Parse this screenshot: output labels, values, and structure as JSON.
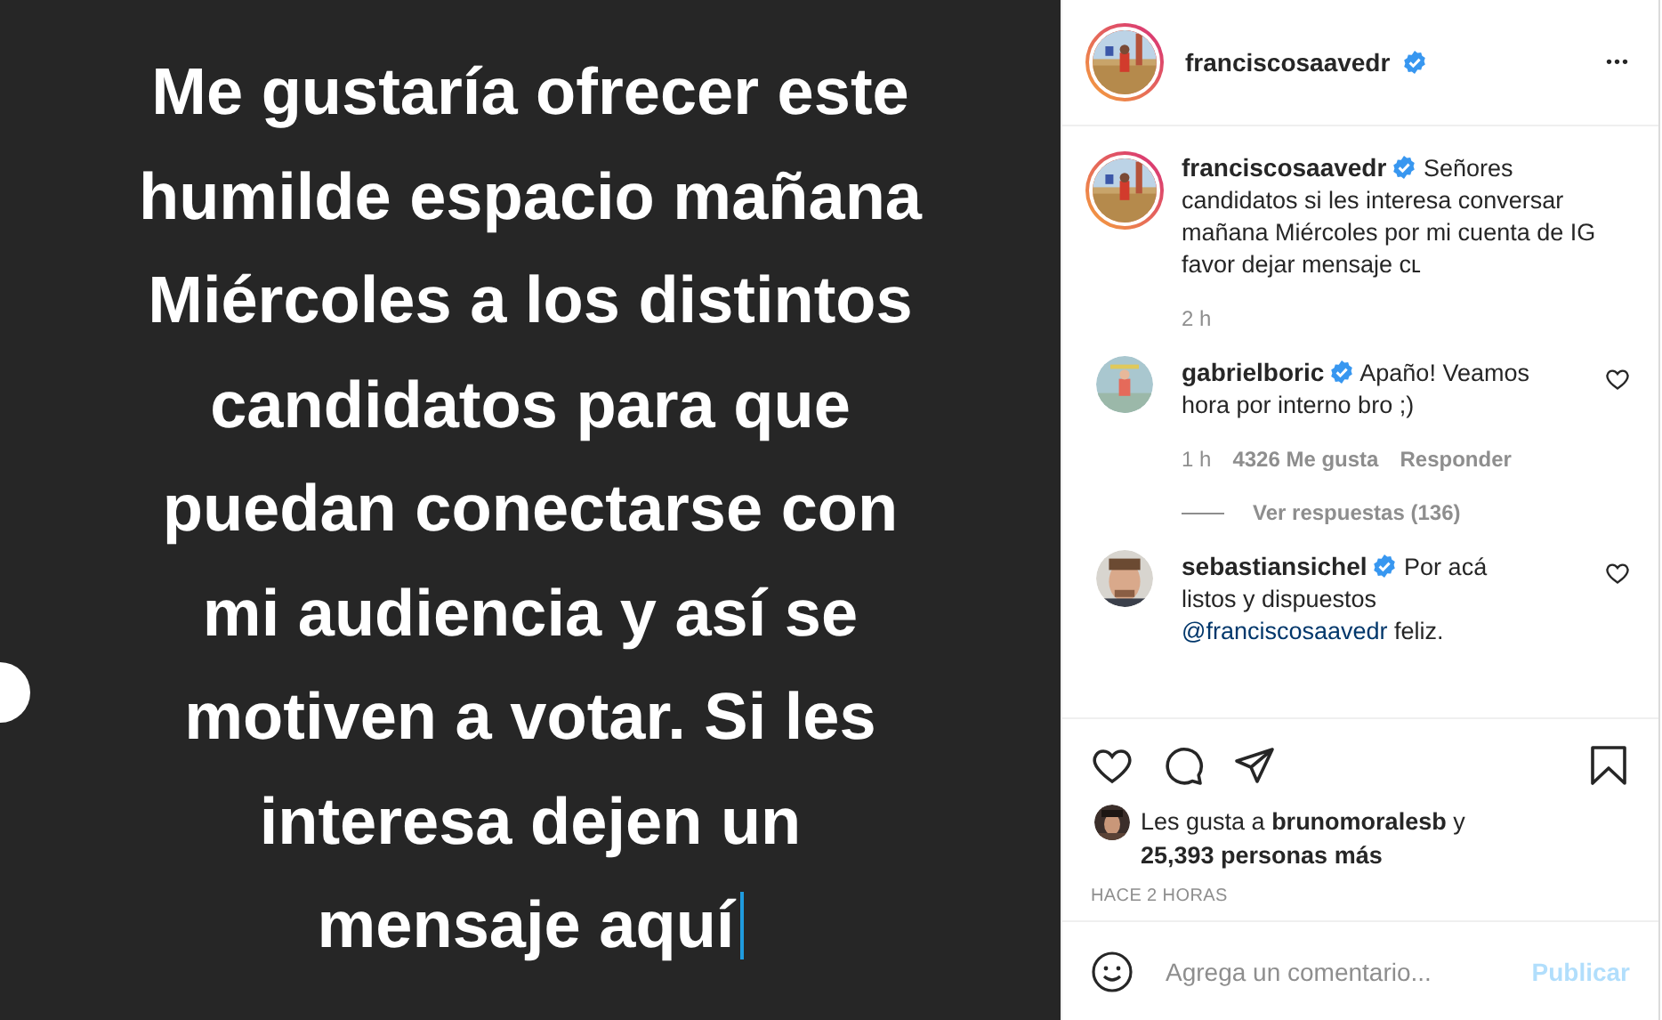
{
  "story": {
    "text": "Me gustaría ofrecer este\nhumilde espacio mañana\nMiércoles a los distintos\ncandidatos para que\npuedan conectarse con\nmi audiencia y así se\nmotiven a votar. Si les\ninteresa dejen un\nmensaje aquí",
    "cursor": true
  },
  "header": {
    "username": "franciscosaavedr",
    "verified": true,
    "more": "•••"
  },
  "caption": {
    "username": "franciscosaavedr",
    "verified": true,
    "text": "Señores candidatos si les interesa conversar mañana Miércoles por mi cuenta de IG favor dejar mensaje cʟ",
    "time": "2 h"
  },
  "comments": [
    {
      "username": "gabrielboric",
      "verified": true,
      "parts": [
        {
          "kind": "text",
          "text": "Apaño! Veamos hora por interno bro ;)"
        }
      ],
      "time": "1 h",
      "likes": "4326 Me gusta",
      "reply": "Responder",
      "replies": "Ver respuestas (136)",
      "liked": false
    },
    {
      "username": "sebastiansichel",
      "verified": true,
      "parts": [
        {
          "kind": "text",
          "text": "Por acá listos y dispuestos "
        },
        {
          "kind": "mention",
          "text": "@franciscosaavedr"
        },
        {
          "kind": "text",
          "text": " feliz."
        }
      ],
      "liked": false
    }
  ],
  "actions": {
    "liked": false,
    "saved": false
  },
  "likes": {
    "prefix": "Les gusta a ",
    "user": "brunomoralesb",
    "middle": " y",
    "others": "25,393 personas más"
  },
  "timestamp": "HACE 2 HORAS",
  "composer": {
    "placeholder": "Agrega un comentario...",
    "button": "Publicar",
    "disabled": true
  }
}
